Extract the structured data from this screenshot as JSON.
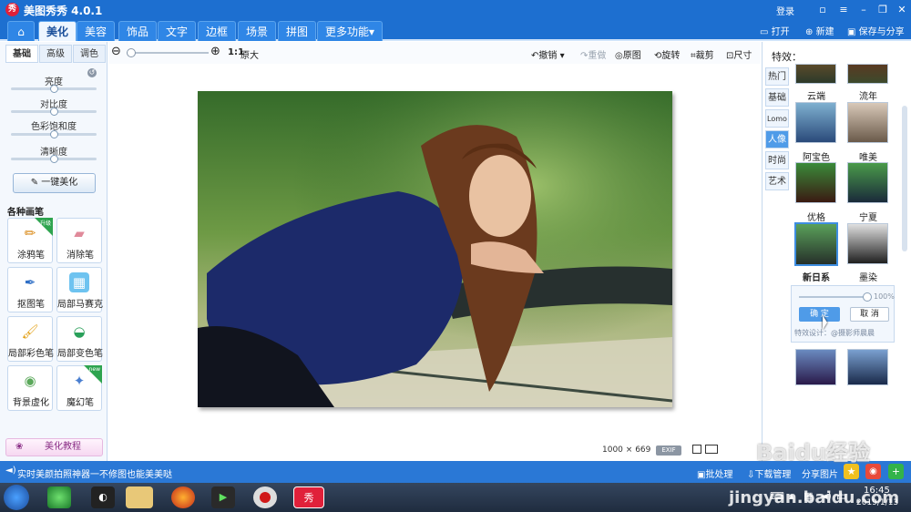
{
  "app": {
    "title": "美图秀秀 4.0.1",
    "logo": "秀",
    "login": "登录"
  },
  "menu": {
    "tabs": [
      "美化",
      "美容",
      "饰品",
      "文字",
      "边框",
      "场景",
      "拼图",
      "更多功能"
    ],
    "more_arrow": "▾",
    "actions": {
      "open": "打开",
      "new": "新建",
      "save": "保存与分享"
    }
  },
  "left": {
    "subtabs": [
      "基础",
      "高级",
      "调色"
    ],
    "sliders": [
      {
        "label": "亮度",
        "value": 0.5
      },
      {
        "label": "对比度",
        "value": 0.5
      },
      {
        "label": "色彩饱和度",
        "value": 0.5
      },
      {
        "label": "清晰度",
        "value": 0.5
      }
    ],
    "one_click": "一键美化",
    "brush_header": "各种画笔",
    "brushes": [
      {
        "label": "涂鸦笔",
        "badge": "升级"
      },
      {
        "label": "消除笔"
      },
      {
        "label": "抠图笔"
      },
      {
        "label": "局部马赛克"
      },
      {
        "label": "局部彩色笔"
      },
      {
        "label": "局部变色笔"
      },
      {
        "label": "背景虚化"
      },
      {
        "label": "魔幻笔",
        "badge": "new"
      }
    ],
    "tutorial": "美化教程"
  },
  "toolbar": {
    "zoom_ratio": "1:1",
    "zoom_label": "原大",
    "zoom_value": 0.0,
    "undo": "撤销",
    "redo": "重做",
    "original": "原图",
    "rotate": "旋转",
    "crop": "裁剪",
    "resize": "尺寸"
  },
  "canvas": {
    "dims_w": "1000",
    "dims_x": "×",
    "dims_h": "669",
    "exif": "EXIF"
  },
  "right": {
    "header": "特效：",
    "tabs": [
      "热门",
      "基础",
      "Lomo",
      "人像",
      "时尚",
      "艺术"
    ],
    "active_tab": "人像",
    "effects": [
      [
        "云端",
        "流年"
      ],
      [
        "阿宝色",
        "唯美"
      ],
      [
        "优格",
        "宁夏"
      ],
      [
        "新日系",
        "墨染"
      ]
    ],
    "popup": {
      "percent": "100%",
      "ok": "确 定",
      "cancel": "取 消",
      "designer": "特效设计：@摄影师晨晨"
    }
  },
  "status": {
    "tip": "实时美颜拍照神器一不修图也能美美哒",
    "batch": "批处理",
    "download": "下载管理",
    "share": "分享图片"
  },
  "taskbar": {
    "time": "16:45",
    "date": "2019/1/13",
    "watermark": "Baidu经验",
    "watermark_url": "jingyan.baidu.com"
  }
}
